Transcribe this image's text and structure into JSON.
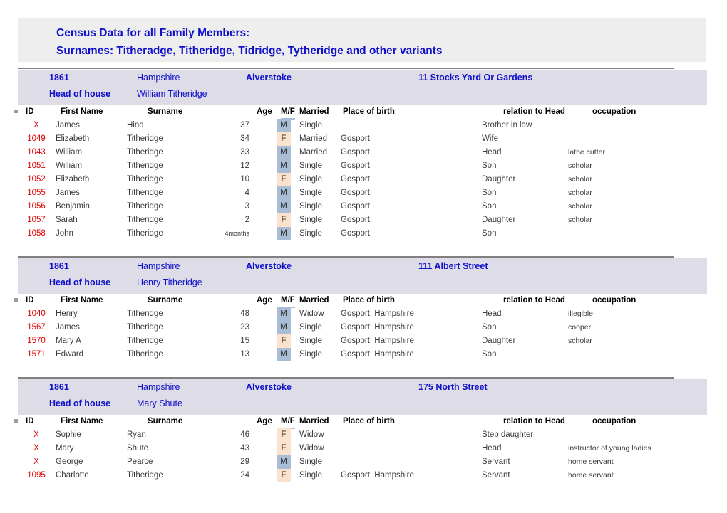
{
  "title": {
    "line1": "Census Data for all Family Members:",
    "line2": "Surnames: Titheradge, Titheridge, Tidridge, Tytheridge and other variants"
  },
  "columns": {
    "id": "ID",
    "first_name": "First Name",
    "surname": "Surname",
    "age": "Age",
    "mf": "M/F",
    "married": "Married",
    "place_of_birth": "Place of birth",
    "relation": "relation to Head",
    "occupation": "occupation"
  },
  "labels": {
    "head_of_house": "Head of house"
  },
  "colors": {
    "title_text": "#1111cc",
    "title_background": "#eeeeee",
    "band_background": "#dddce7",
    "id_text": "#dd0000",
    "male_cell": "#a9bdd6",
    "female_cell": "#fbe2cc"
  },
  "households": [
    {
      "year": "1861",
      "county": "Hampshire",
      "parish": "Alverstoke",
      "address": "11 Stocks Yard Or Gardens",
      "head_of_house": "William Titheridge",
      "people": [
        {
          "id": "X",
          "first_name": "James",
          "surname": "Hind",
          "age": "37",
          "mf": "M",
          "married": "Single",
          "place_of_birth": "",
          "relation": "Brother in law",
          "occupation": ""
        },
        {
          "id": "1049",
          "first_name": "Elizabeth",
          "surname": "Titheridge",
          "age": "34",
          "mf": "F",
          "married": "Married",
          "place_of_birth": "Gosport",
          "relation": "Wife",
          "occupation": ""
        },
        {
          "id": "1043",
          "first_name": "William",
          "surname": "Titheridge",
          "age": "33",
          "mf": "M",
          "married": "Married",
          "place_of_birth": "Gosport",
          "relation": "Head",
          "occupation": "lathe cutter"
        },
        {
          "id": "1051",
          "first_name": "William",
          "surname": "Titheridge",
          "age": "12",
          "mf": "M",
          "married": "Single",
          "place_of_birth": "Gosport",
          "relation": "Son",
          "occupation": "scholar"
        },
        {
          "id": "1052",
          "first_name": "Elizabeth",
          "surname": "Titheridge",
          "age": "10",
          "mf": "F",
          "married": "Single",
          "place_of_birth": "Gosport",
          "relation": "Daughter",
          "occupation": "scholar"
        },
        {
          "id": "1055",
          "first_name": "James",
          "surname": "Titheridge",
          "age": "4",
          "mf": "M",
          "married": "Single",
          "place_of_birth": "Gosport",
          "relation": "Son",
          "occupation": "scholar"
        },
        {
          "id": "1056",
          "first_name": "Benjamin",
          "surname": "Titheridge",
          "age": "3",
          "mf": "M",
          "married": "Single",
          "place_of_birth": "Gosport",
          "relation": "Son",
          "occupation": "scholar"
        },
        {
          "id": "1057",
          "first_name": "Sarah",
          "surname": "Titheridge",
          "age": "2",
          "mf": "F",
          "married": "Single",
          "place_of_birth": "Gosport",
          "relation": "Daughter",
          "occupation": "scholar"
        },
        {
          "id": "1058",
          "first_name": "John",
          "surname": "Titheridge",
          "age": "4months",
          "mf": "M",
          "married": "Single",
          "place_of_birth": "Gosport",
          "relation": "Son",
          "occupation": ""
        }
      ]
    },
    {
      "year": "1861",
      "county": "Hampshire",
      "parish": "Alverstoke",
      "address": "111 Albert Street",
      "head_of_house": "Henry Titheridge",
      "people": [
        {
          "id": "1040",
          "first_name": "Henry",
          "surname": "Titheridge",
          "age": "48",
          "mf": "M",
          "married": "Widow",
          "place_of_birth": "Gosport, Hampshire",
          "relation": "Head",
          "occupation": "illegible"
        },
        {
          "id": "1567",
          "first_name": "James",
          "surname": "Titheridge",
          "age": "23",
          "mf": "M",
          "married": "Single",
          "place_of_birth": "Gosport, Hampshire",
          "relation": "Son",
          "occupation": "cooper"
        },
        {
          "id": "1570",
          "first_name": "Mary A",
          "surname": "Titheridge",
          "age": "15",
          "mf": "F",
          "married": "Single",
          "place_of_birth": "Gosport, Hampshire",
          "relation": "Daughter",
          "occupation": "scholar"
        },
        {
          "id": "1571",
          "first_name": "Edward",
          "surname": "Titheridge",
          "age": "13",
          "mf": "M",
          "married": "Single",
          "place_of_birth": "Gosport, Hampshire",
          "relation": "Son",
          "occupation": ""
        }
      ]
    },
    {
      "year": "1861",
      "county": "Hampshire",
      "parish": "Alverstoke",
      "address": "175 North Street",
      "head_of_house": "Mary Shute",
      "people": [
        {
          "id": "X",
          "first_name": "Sophie",
          "surname": "Ryan",
          "age": "46",
          "mf": "F",
          "married": "Widow",
          "place_of_birth": "",
          "relation": "Step daughter",
          "occupation": ""
        },
        {
          "id": "X",
          "first_name": "Mary",
          "surname": "Shute",
          "age": "43",
          "mf": "F",
          "married": "Widow",
          "place_of_birth": "",
          "relation": "Head",
          "occupation": "instructor of young ladies"
        },
        {
          "id": "X",
          "first_name": "George",
          "surname": "Pearce",
          "age": "29",
          "mf": "M",
          "married": "Single",
          "place_of_birth": "",
          "relation": "Servant",
          "occupation": "home servant"
        },
        {
          "id": "1095",
          "first_name": "Charlotte",
          "surname": "Titheridge",
          "age": "24",
          "mf": "F",
          "married": "Single",
          "place_of_birth": "Gosport, Hampshire",
          "relation": "Servant",
          "occupation": "home servant"
        }
      ]
    }
  ]
}
